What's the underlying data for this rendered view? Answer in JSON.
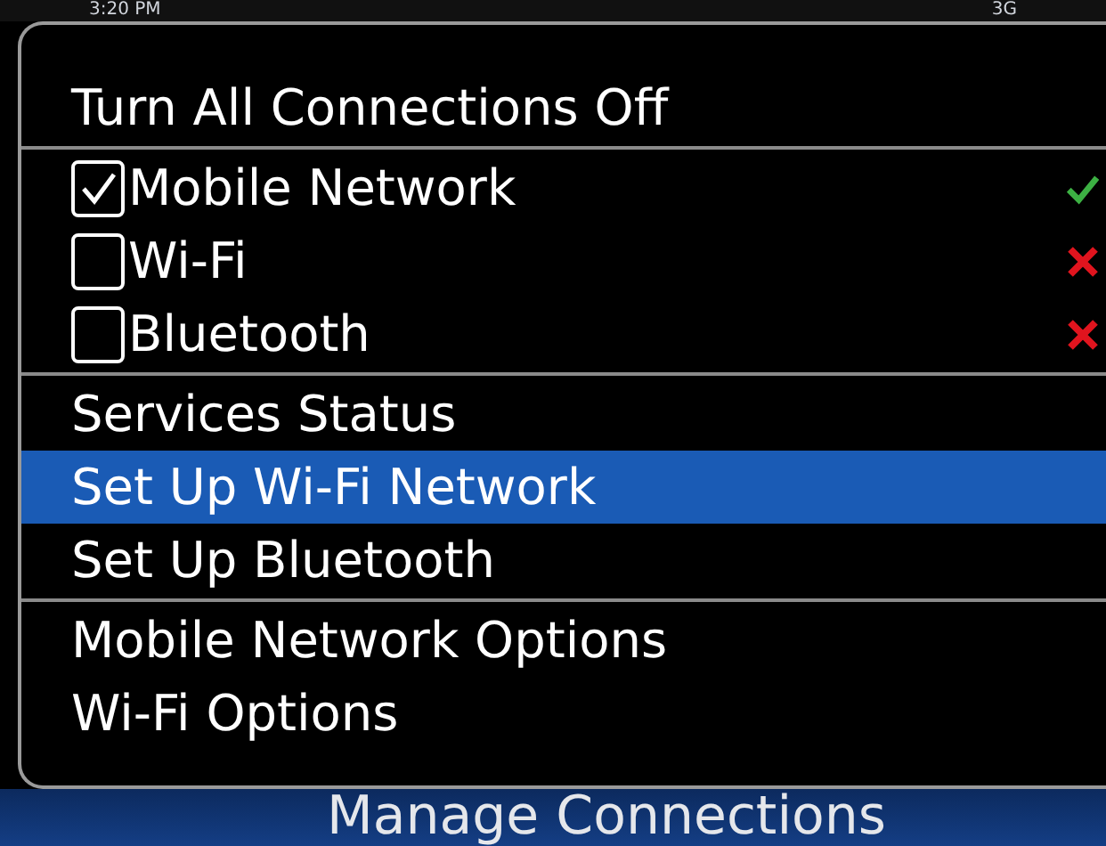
{
  "status_bar": {
    "time": "3:20 PM",
    "network": "3G"
  },
  "menu": {
    "groups": [
      [
        {
          "kind": "item",
          "label": "Turn All Connections Off",
          "selected": false
        }
      ],
      [
        {
          "kind": "checkbox",
          "label": "Mobile Network",
          "checked": true,
          "connected": true,
          "selected": false
        },
        {
          "kind": "checkbox",
          "label": "Wi-Fi",
          "checked": false,
          "connected": false,
          "selected": false
        },
        {
          "kind": "checkbox",
          "label": "Bluetooth",
          "checked": false,
          "connected": false,
          "selected": false
        }
      ],
      [
        {
          "kind": "item",
          "label": "Services Status",
          "selected": false
        },
        {
          "kind": "item",
          "label": "Set Up Wi-Fi Network",
          "selected": true
        },
        {
          "kind": "item",
          "label": "Set Up Bluetooth",
          "selected": false
        }
      ],
      [
        {
          "kind": "item",
          "label": "Mobile Network Options",
          "selected": false
        },
        {
          "kind": "item",
          "label": "Wi-Fi Options",
          "selected": false
        }
      ]
    ]
  },
  "title": "Manage Connections"
}
